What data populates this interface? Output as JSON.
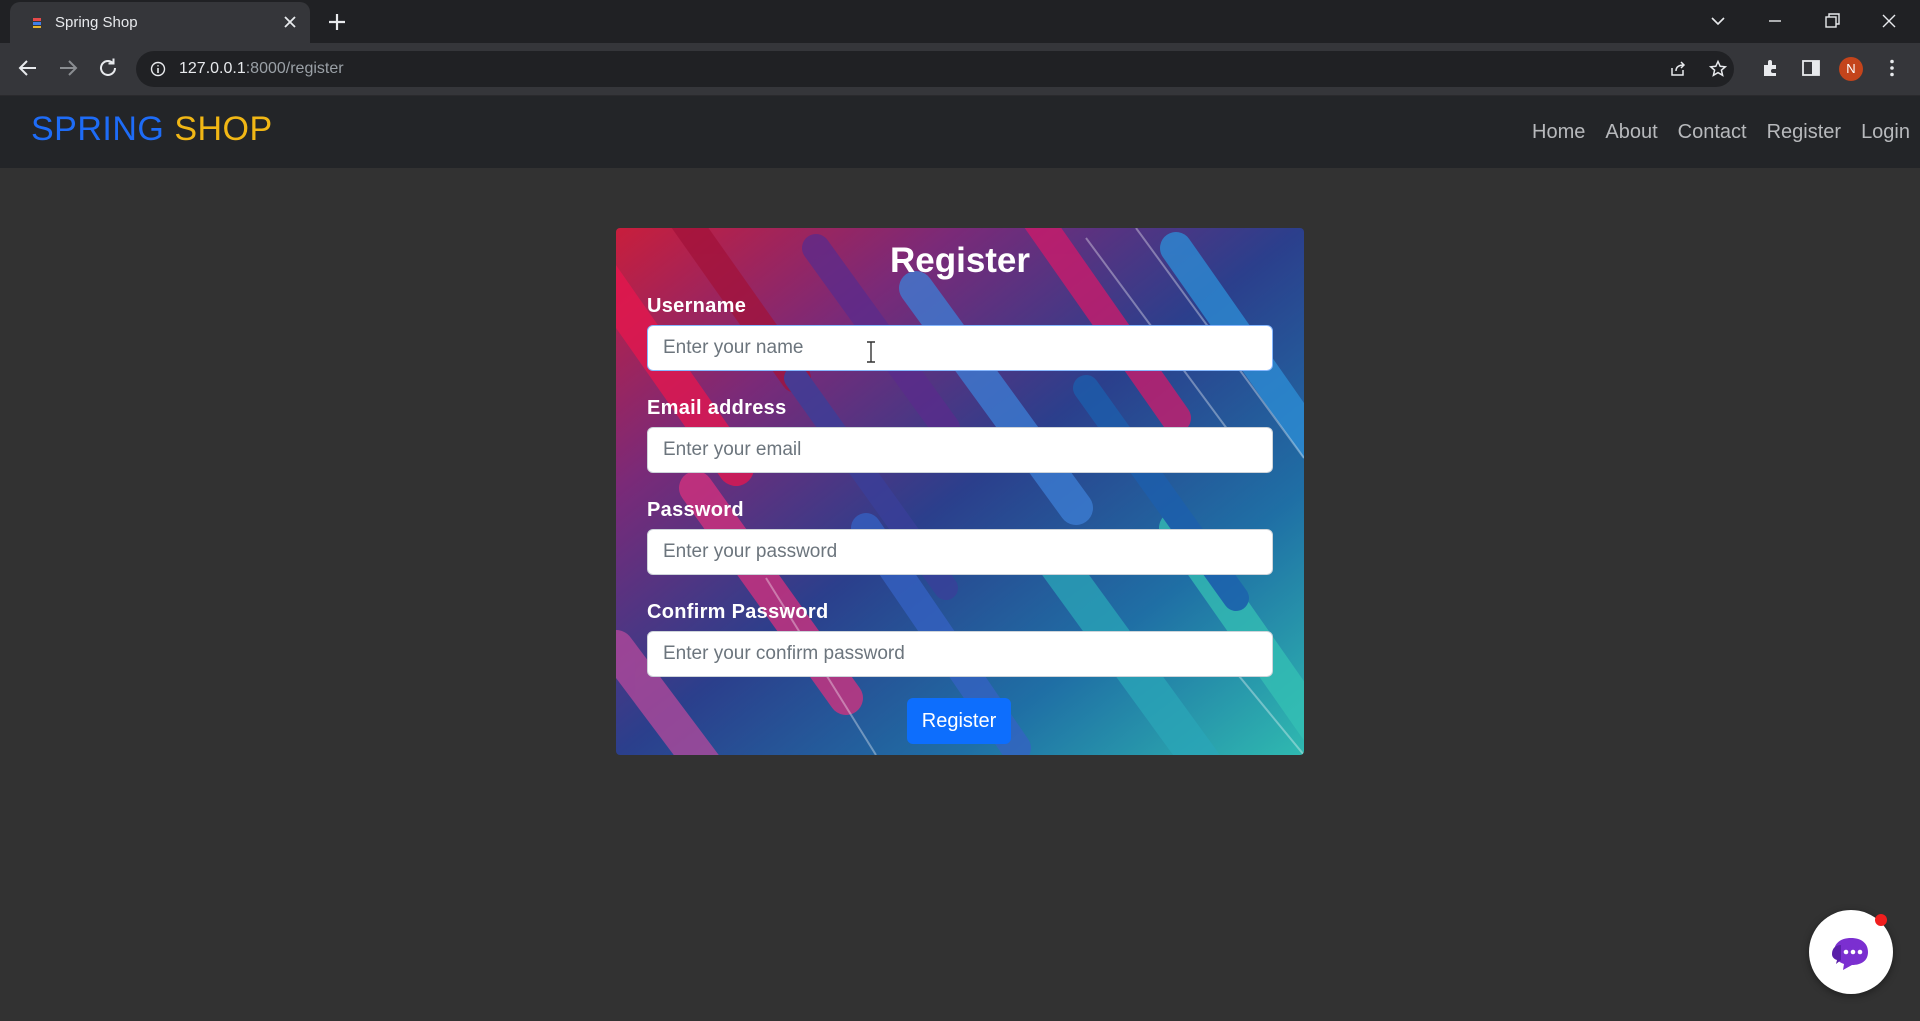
{
  "browser": {
    "tab_title": "Spring Shop",
    "url_host": "127.0.0.1",
    "url_rest": ":8000/register",
    "profile_initial": "N"
  },
  "site": {
    "brand_part1": "SPRING",
    "brand_part2": "SHOP",
    "brand_colors": {
      "part1": "#1e6cf7",
      "part2": "#f1b715"
    },
    "nav": [
      "Home",
      "About",
      "Contact",
      "Register",
      "Login"
    ]
  },
  "form": {
    "title": "Register",
    "fields": [
      {
        "label": "Username",
        "placeholder": "Enter your name",
        "value": ""
      },
      {
        "label": "Email address",
        "placeholder": "Enter your email",
        "value": ""
      },
      {
        "label": "Password",
        "placeholder": "Enter your password",
        "value": ""
      },
      {
        "label": "Confirm Password",
        "placeholder": "Enter your confirm password",
        "value": ""
      }
    ],
    "submit_label": "Register",
    "accent_color": "#0d6efd"
  },
  "chat": {
    "icon": "chat-bubbles-icon",
    "has_notification": true
  }
}
